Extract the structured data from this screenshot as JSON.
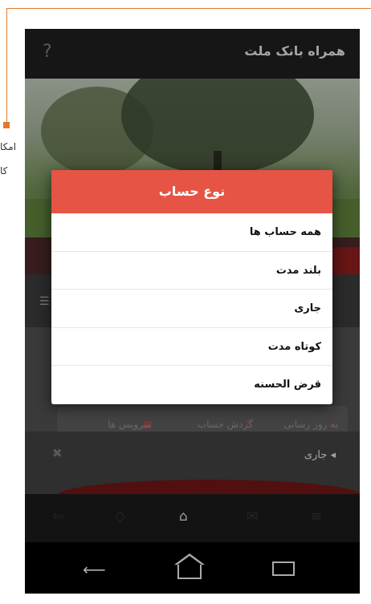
{
  "page": {
    "side_text_1": "امکا",
    "side_text_2": "کا"
  },
  "app_bar": {
    "title": "همراه بانک ملت",
    "help_icon": "?"
  },
  "services": {
    "refresh_label": "به روز رسانی",
    "turnover_label": "گردش حساب",
    "services_label": "سرویس ها"
  },
  "account_row": {
    "label": "◂ جاری",
    "pin_icon": "pin-icon"
  },
  "dialog": {
    "title": "نوع حساب",
    "options": [
      "همه حساب ها",
      "بلند مدت",
      "جاری",
      "کوتاه مدت",
      "قرض الحسنه"
    ]
  },
  "bottom_nav": {
    "icons": [
      "exit-icon",
      "transfer-icon",
      "home-icon",
      "mail-icon",
      "menu-icon"
    ],
    "active": "home-icon"
  },
  "system_nav": {
    "icons": [
      "back-icon",
      "home-icon",
      "recent-apps-icon"
    ]
  },
  "colors": {
    "accent": "#e65445",
    "app_bar": "#1e1e1e",
    "annotation": "#e07a2f"
  }
}
